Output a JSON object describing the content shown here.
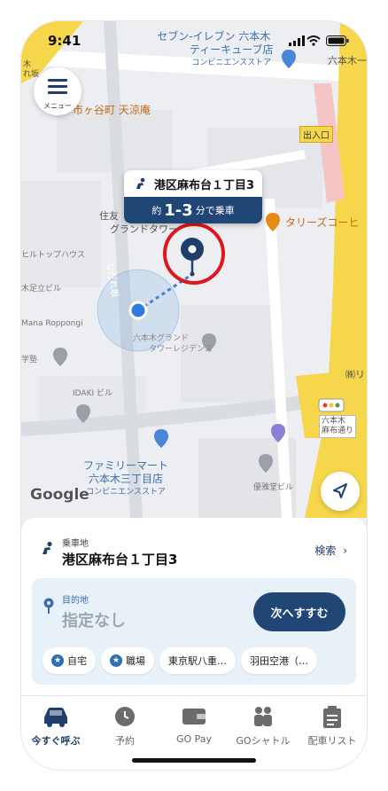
{
  "status_bar": {
    "time": "9:41"
  },
  "map": {
    "menu_label": "メニュー",
    "pickup_popup": {
      "address": "港区麻布台１丁目3",
      "eta_prefix": "約",
      "eta_value": "1-3",
      "eta_suffix": "分で乗車"
    },
    "labels": {
      "seven_eleven_1": "セブン-イレブン 六本木",
      "seven_eleven_2": "ティーキューブ店",
      "seven_eleven_3": "コンビニエンスストア",
      "roppongi_1": "六本木一",
      "tenryuan": "市ヶ谷町 天涼庵",
      "entrance": "出入口",
      "sumitomo_1": "住友",
      "sumitomo_2": "グランドタワー",
      "tullys": "タリーズコーヒ",
      "hilltop": "ヒルトップハウス",
      "adachi": "木足立ビル",
      "mana": "Mana Roppongi",
      "gakujuku": "学塾",
      "roppongi_grand_1": "六本木グランド",
      "roppongi_grand_2": "タワーレジデンス",
      "kabu": "㈱リ",
      "idaki": "IDAKI ビル",
      "roppongi_dori_1": "六本木",
      "roppongi_dori_2": "麻布通り",
      "familymart_1": "ファミリーマート",
      "familymart_2": "六本木三丁目店",
      "familymart_3": "コンビニエンスストア",
      "yuseido": "優雅堂ビル",
      "street": "なだれ坂",
      "google": "Google",
      "top_left_1": "木",
      "top_left_2": "れ坂"
    }
  },
  "sheet": {
    "pickup_label": "乗車地",
    "pickup_value": "港区麻布台１丁目3",
    "search_label": "検索",
    "destination_label": "目的地",
    "destination_placeholder": "指定なし",
    "next_button": "次へすすむ",
    "chips": [
      "自宅",
      "職場",
      "東京駅八重…",
      "羽田空港（…"
    ]
  },
  "tabs": [
    {
      "label": "今すぐ呼ぶ",
      "icon": "car-icon",
      "active": true
    },
    {
      "label": "予約",
      "icon": "clock-icon",
      "active": false
    },
    {
      "label": "GO Pay",
      "icon": "wallet-icon",
      "active": false
    },
    {
      "label": "GOシャトル",
      "icon": "shuttle-people-icon",
      "active": false
    },
    {
      "label": "配車リスト",
      "icon": "clipboard-icon",
      "active": false
    }
  ],
  "colors": {
    "brand_navy": "#1f4675",
    "road_yellow": "#f6d64a",
    "pin_ring_red": "#e0161d"
  }
}
